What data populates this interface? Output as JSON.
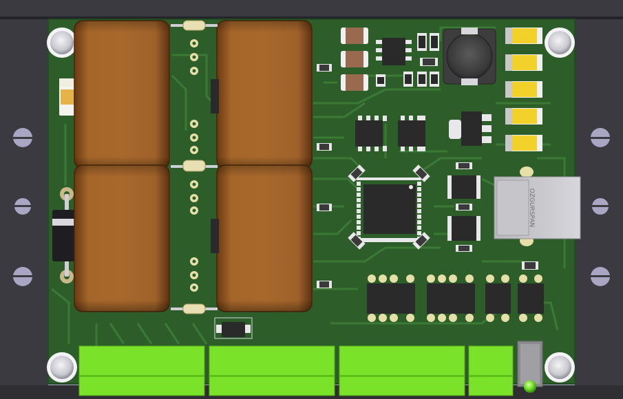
{
  "board": {
    "usb_connector_label": "OZGURSPAN",
    "colors": {
      "pcb_green": "#2d5e2a",
      "trace_green": "#3b7a36",
      "enclosure": "#3a3a40",
      "capacitor_brown": "#9a5a22",
      "terminal_lime": "#7be22a",
      "copper_pad": "#c9b98a",
      "ic_black": "#2a2a2a",
      "smd_yellow": "#f2d12a",
      "led_green": "#6fe02a"
    }
  }
}
